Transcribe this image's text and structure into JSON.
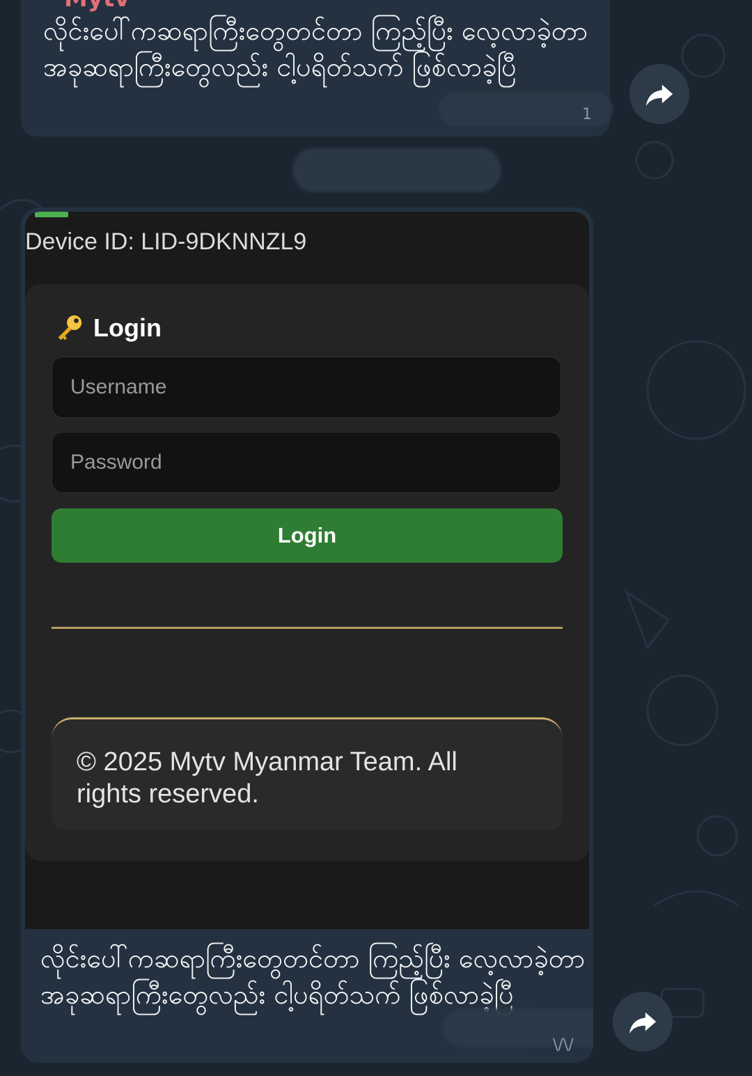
{
  "chat": {
    "sender_name": "Mytv",
    "message_text": "လိုင်းပေါ်ကဆရာကြီးတွေတင်တာ ကြည့်ပြီး လေ့လာခဲ့တာ အခုဆရာကြီးတွေလည်း ငါ့ပရိတ်သက် ဖြစ်လာခဲ့ပြီ",
    "meta_top": "1",
    "meta_bottom": "\\/\\/"
  },
  "photo": {
    "device_id": "Device ID: LID-9DKNNZL9",
    "login_title": "Login",
    "username_placeholder": "Username",
    "password_placeholder": "Password",
    "login_button": "Login",
    "footer": "© 2025 Mytv Myanmar Team. All rights reserved."
  },
  "colors": {
    "background": "#1b2530",
    "bubble": "#243140",
    "sender": "#e17076",
    "login_button": "#2e7d32",
    "gold_accent": "#c9ad6a"
  },
  "icons": {
    "forward": "forward-arrow-icon",
    "key": "key-icon"
  }
}
